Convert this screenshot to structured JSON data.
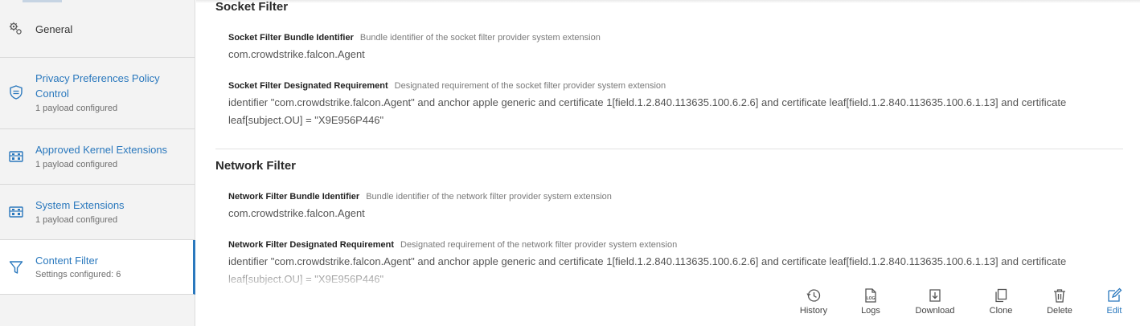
{
  "sidebar": {
    "items": [
      {
        "label": "General",
        "sub": "",
        "icon": "gears-icon"
      },
      {
        "label": "Privacy Preferences Policy Control",
        "label_line1": "Privacy Preferences Policy",
        "label_line2": "Control",
        "sub": "1 payload configured",
        "icon": "shield-icon"
      },
      {
        "label": "Approved Kernel Extensions",
        "sub": "1 payload configured",
        "icon": "extension-icon"
      },
      {
        "label": "System Extensions",
        "sub": "1 payload configured",
        "icon": "extension-icon"
      },
      {
        "label": "Content Filter",
        "sub": "Settings configured: 6",
        "icon": "filter-icon",
        "active": true
      }
    ]
  },
  "main": {
    "socket": {
      "title": "Socket Filter",
      "bundle_label": "Socket Filter Bundle Identifier",
      "bundle_desc": "Bundle identifier of the socket filter provider system extension",
      "bundle_value": "com.crowdstrike.falcon.Agent",
      "req_label": "Socket Filter Designated Requirement",
      "req_desc": "Designated requirement of the socket filter provider system extension",
      "req_value": "identifier \"com.crowdstrike.falcon.Agent\" and anchor apple generic and certificate 1[field.1.2.840.113635.100.6.2.6] and certificate leaf[field.1.2.840.113635.100.6.1.13] and certificate leaf[subject.OU] = \"X9E956P446\""
    },
    "network": {
      "title": "Network Filter",
      "bundle_label": "Network Filter Bundle Identifier",
      "bundle_desc": "Bundle identifier of the network filter provider system extension",
      "bundle_value": "com.crowdstrike.falcon.Agent",
      "req_label": "Network Filter Designated Requirement",
      "req_desc": "Designated requirement of the network filter provider system extension",
      "req_value": "identifier \"com.crowdstrike.falcon.Agent\" and anchor apple generic and certificate 1[field.1.2.840.113635.100.6.2.6] and certificate leaf[field.1.2.840.113635.100.6.1.13] and certificate leaf[subject.OU] = \"X9E956P446\""
    }
  },
  "actions": {
    "history": "History",
    "logs": "Logs",
    "logs_icon_text": "LOG",
    "download": "Download",
    "clone": "Clone",
    "delete": "Delete",
    "edit": "Edit"
  },
  "colors": {
    "accent": "#2a78bd",
    "sidebar_bg": "#f3f3f3"
  }
}
